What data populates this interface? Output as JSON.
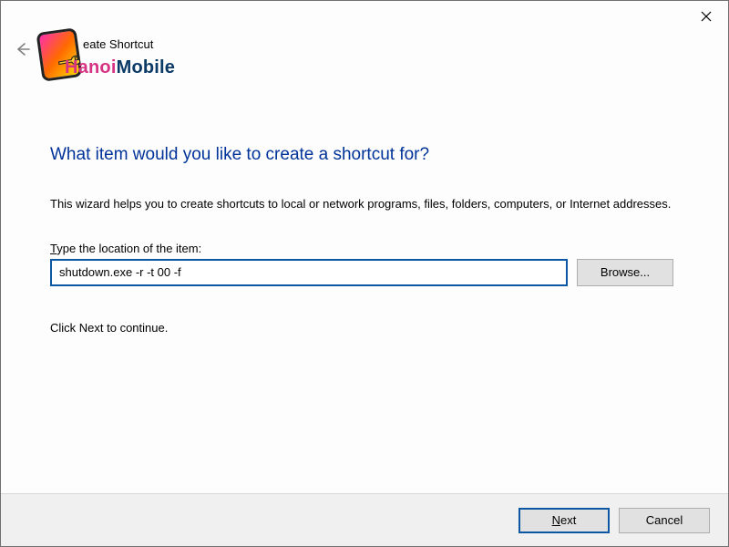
{
  "window": {
    "breadcrumb_visible": "eate Shortcut",
    "page_title_full": "Create Shortcut"
  },
  "brand": {
    "prefix": "H",
    "rest_pink": "anoi",
    "rest_blue": "Mobile"
  },
  "main": {
    "heading": "What item would you like to create a shortcut for?",
    "description": "This wizard helps you to create shortcuts to local or network programs, files, folders, computers, or Internet addresses.",
    "field_label_pre": "T",
    "field_label_rest": "ype the location of the item:",
    "location_value": "shutdown.exe -r -t 00 -f",
    "browse_label": "Browse...",
    "hint": "Click Next to continue."
  },
  "footer": {
    "next_accel": "N",
    "next_rest": "ext",
    "cancel_label": "Cancel"
  },
  "icons": {
    "close": "close-icon",
    "back": "back-arrow-icon",
    "logo": "hanoimobile-logo"
  }
}
